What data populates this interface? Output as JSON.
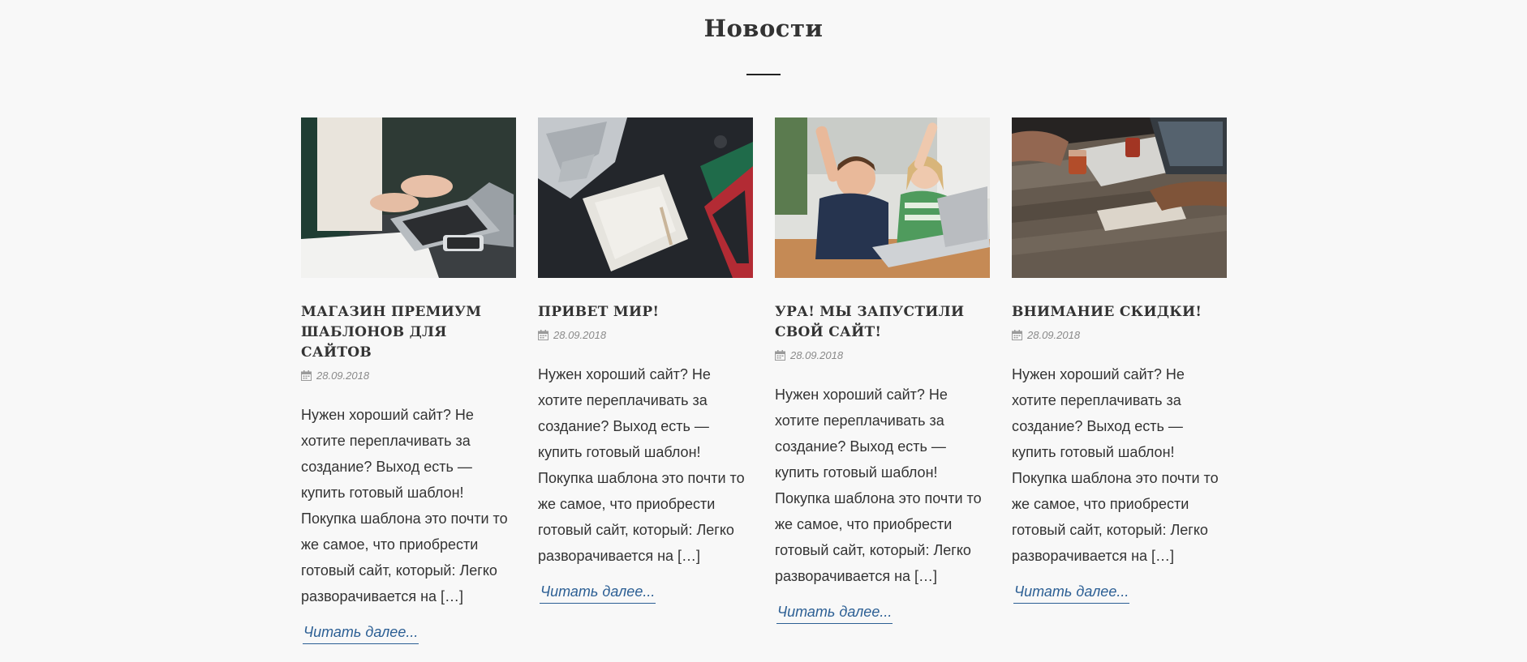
{
  "section": {
    "title": "Новости"
  },
  "news": [
    {
      "image": "woman typing on laptop with phone and notebook",
      "title": "Магазин премиум шаблонов для сайтов",
      "date": "28.09.2018",
      "excerpt": "Нужен хороший сайт? Не хотите переплачивать за создание? Выход есть — купить готовый шаблон! Покупка шаблона это почти то же самое, что приобрести готовый сайт, который: Легко разворачивается на […]",
      "read_more": "Читать далее..."
    },
    {
      "image": "laptop and notebooks on dark desk",
      "title": "Привет мир!",
      "date": "28.09.2018",
      "excerpt": "Нужен хороший сайт? Не хотите переплачивать за создание? Выход есть — купить готовый шаблон! Покупка шаблона это почти то же самое, что приобрести готовый сайт, который: Легко разворачивается на […]",
      "read_more": "Читать далее..."
    },
    {
      "image": "two excited children in front of a laptop",
      "title": "Ура! Мы запустили свой сайт!",
      "date": "28.09.2018",
      "excerpt": "Нужен хороший сайт? Не хотите переплачивать за создание? Выход есть — купить готовый шаблон! Покупка шаблона это почти то же самое, что приобрести готовый сайт, который: Легко разворачивается на […]",
      "read_more": "Читать далее..."
    },
    {
      "image": "people working at a wooden table with laptop and drinks",
      "title": "Внимание скидки!",
      "date": "28.09.2018",
      "excerpt": "Нужен хороший сайт? Не хотите переплачивать за создание? Выход есть — купить готовый шаблон! Покупка шаблона это почти то же самое, что приобрести готовый сайт, который: Легко разворачивается на […]",
      "read_more": "Читать далее..."
    }
  ],
  "icons": {
    "date": "calendar-icon"
  },
  "colors": {
    "background": "#f8f8f8",
    "text": "#333333",
    "link": "#2c5f94",
    "meta": "#8a8a8a"
  }
}
